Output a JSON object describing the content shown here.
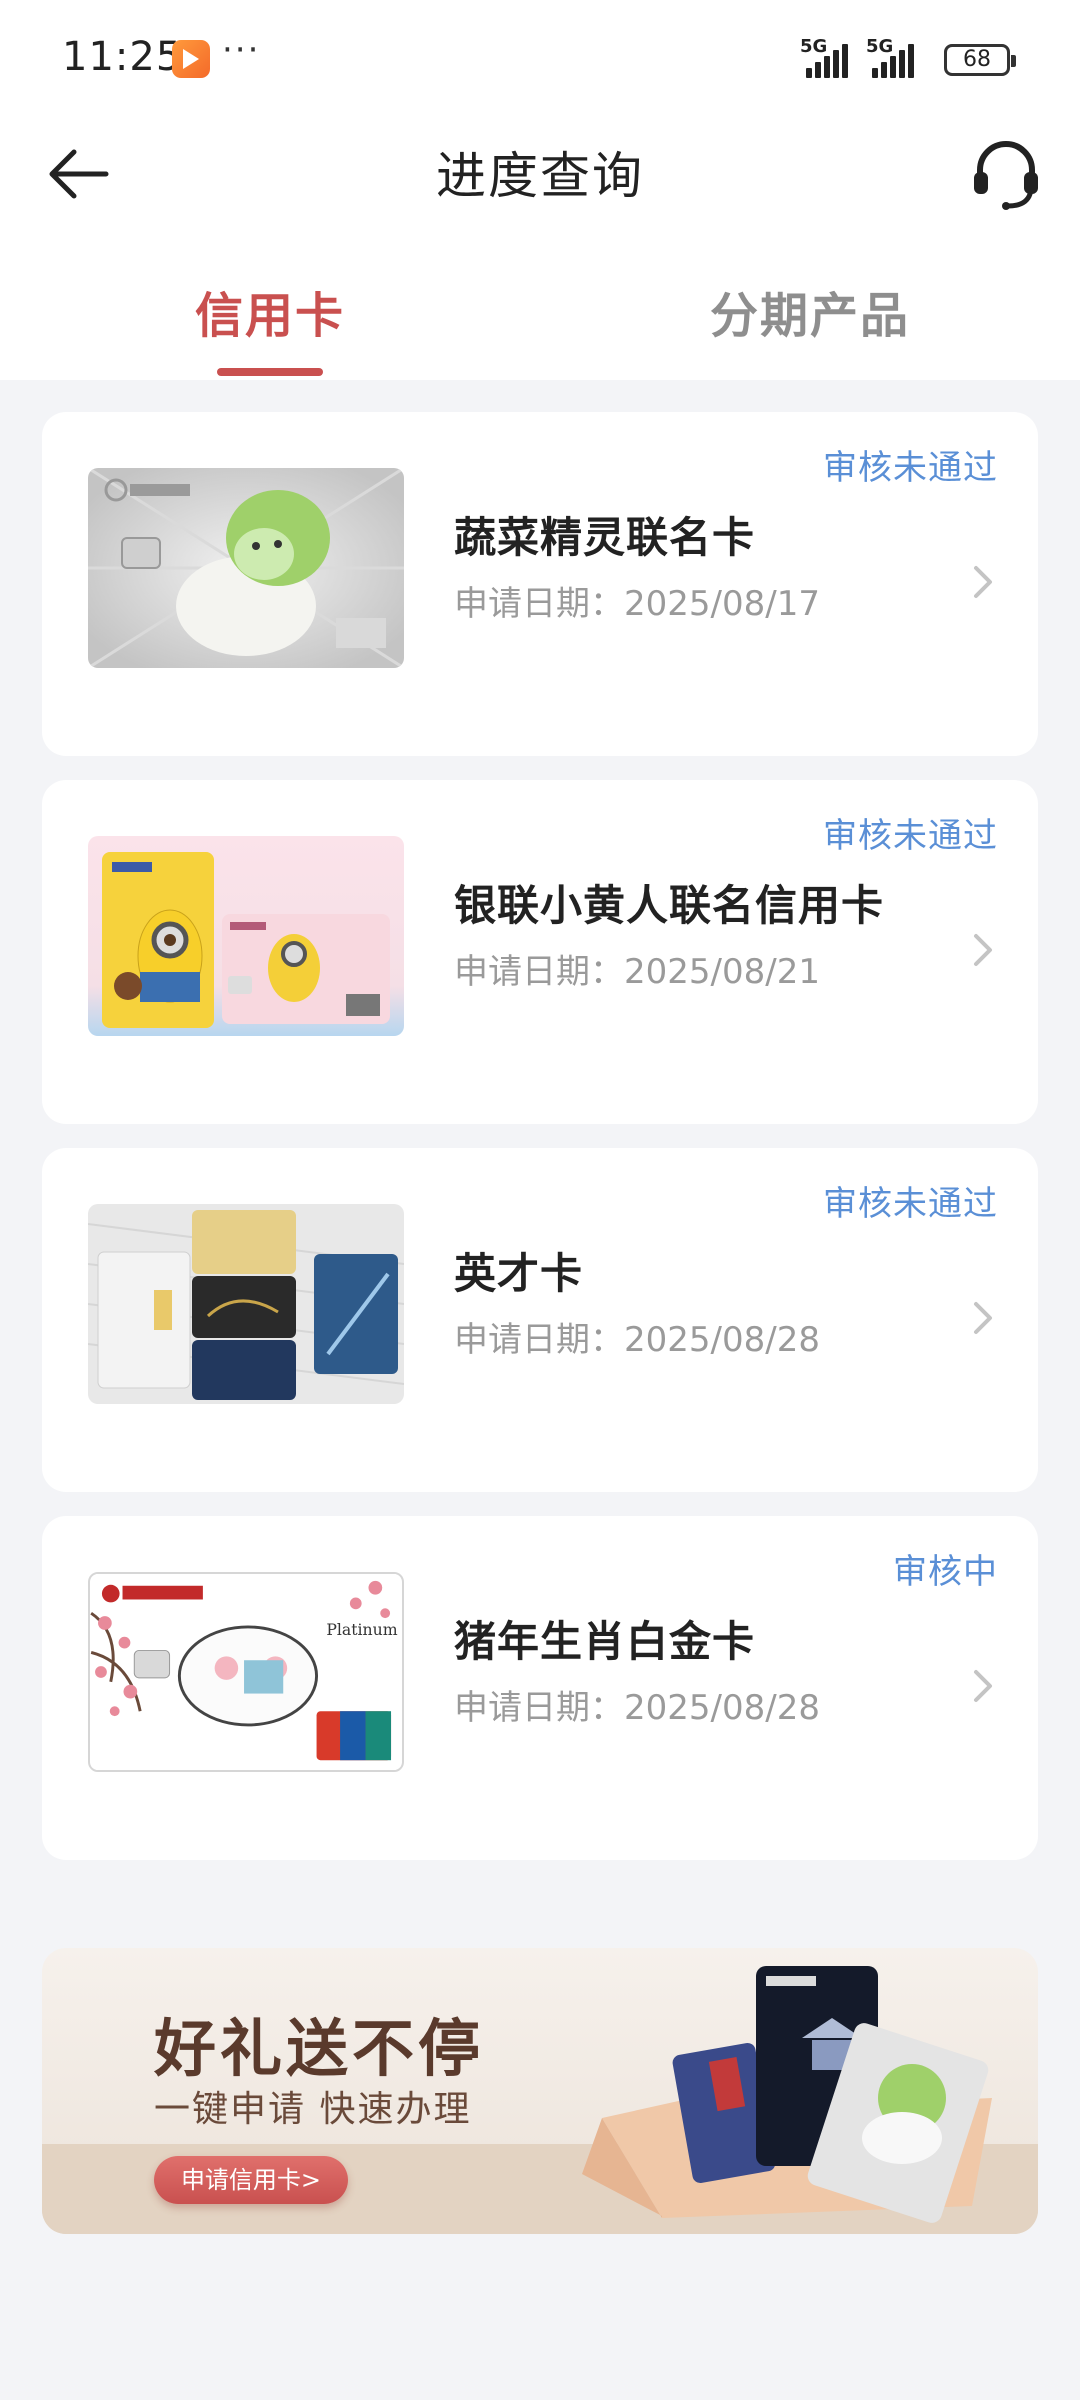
{
  "status_bar": {
    "time": "11:25",
    "dots": "···",
    "signal_1_label": "5G",
    "signal_2_label": "5G",
    "battery": "68"
  },
  "header": {
    "title": "进度查询",
    "back_icon": "back-arrow-icon",
    "support_icon": "headset-icon"
  },
  "tabs": [
    {
      "label": "信用卡",
      "active": true
    },
    {
      "label": "分期产品",
      "active": false
    }
  ],
  "applications": [
    {
      "name": "蔬菜精灵联名卡",
      "date": "申请日期：2025/08/17",
      "status": "审核未通过"
    },
    {
      "name": "银联小黄人联名信用卡",
      "date": "申请日期：2025/08/21",
      "status": "审核未通过"
    },
    {
      "name": "英才卡",
      "date": "申请日期：2025/08/28",
      "status": "审核未通过"
    },
    {
      "name": "猪年生肖白金卡",
      "date": "申请日期：2025/08/28",
      "status": "审核中"
    }
  ],
  "banner": {
    "title": "好礼送不停",
    "subtitle": "一键申请 快速办理",
    "button": "申请信用卡>"
  },
  "colors": {
    "accent": "#c9504f",
    "status": "#5a8fd6",
    "muted": "#9a9a9a"
  }
}
